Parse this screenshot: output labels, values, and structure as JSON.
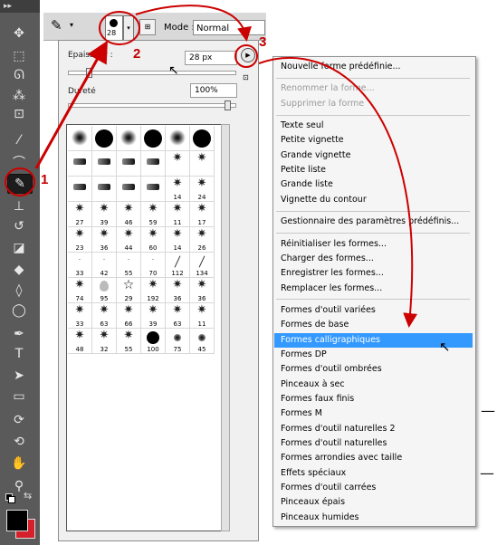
{
  "toolbar": {
    "strip": "▸▸",
    "tools": [
      {
        "name": "move-icon",
        "glyph": "✥"
      },
      {
        "name": "marquee-icon",
        "glyph": "⬚"
      },
      {
        "name": "lasso-icon",
        "glyph": "ᘏ"
      },
      {
        "name": "magic-wand-icon",
        "glyph": "⁂"
      },
      {
        "name": "crop-icon",
        "glyph": "⊡"
      },
      {
        "name": "eyedropper-icon",
        "glyph": "⁄"
      },
      {
        "name": "healing-brush-icon",
        "glyph": "⌒"
      },
      {
        "name": "brush-icon",
        "glyph": "✎"
      },
      {
        "name": "stamp-icon",
        "glyph": "⊥"
      },
      {
        "name": "history-brush-icon",
        "glyph": "↺"
      },
      {
        "name": "eraser-icon",
        "glyph": "◪"
      },
      {
        "name": "paint-bucket-icon",
        "glyph": "◆"
      },
      {
        "name": "blur-icon",
        "glyph": "◊"
      },
      {
        "name": "dodge-icon",
        "glyph": "◯"
      },
      {
        "name": "pen-icon",
        "glyph": "✒"
      },
      {
        "name": "type-icon",
        "glyph": "T"
      },
      {
        "name": "path-selection-icon",
        "glyph": "➤"
      },
      {
        "name": "shape-icon",
        "glyph": "▭"
      },
      {
        "name": "3d-rotate-icon",
        "glyph": "⟳"
      },
      {
        "name": "3d-orbit-icon",
        "glyph": "⟲"
      },
      {
        "name": "hand-icon",
        "glyph": "✋"
      },
      {
        "name": "zoom-icon",
        "glyph": "⚲"
      }
    ]
  },
  "optionsbar": {
    "brush_size": "28",
    "mode_label": "Mode :",
    "mode_value": "Normal"
  },
  "picker": {
    "size_label": "Epaisseur :",
    "size_value": "28 px",
    "hardness_label": "Dureté",
    "hardness_value": "100%"
  },
  "brushes": [
    [
      "",
      "",
      "",
      "",
      "",
      ""
    ],
    [
      "",
      "",
      "",
      "",
      "",
      ""
    ],
    [
      "",
      "",
      "",
      "",
      "14",
      "24"
    ],
    [
      "27",
      "39",
      "46",
      "59",
      "11",
      "17"
    ],
    [
      "23",
      "36",
      "44",
      "60",
      "14",
      "26"
    ],
    [
      "33",
      "42",
      "55",
      "70",
      "112",
      "134"
    ],
    [
      "74",
      "95",
      "29",
      "192",
      "36",
      "36"
    ],
    [
      "33",
      "63",
      "66",
      "39",
      "63",
      "11"
    ],
    [
      "48",
      "32",
      "55",
      "100",
      "75",
      "45"
    ]
  ],
  "menu": {
    "groups": [
      [
        {
          "label": "Nouvelle forme prédéfinie...",
          "disabled": false
        }
      ],
      [
        {
          "label": "Renommer la forme...",
          "disabled": true
        },
        {
          "label": "Supprimer la forme",
          "disabled": true
        }
      ],
      [
        {
          "label": "Texte seul",
          "disabled": false
        },
        {
          "label": "Petite vignette",
          "disabled": false
        },
        {
          "label": "Grande vignette",
          "disabled": false
        },
        {
          "label": "Petite liste",
          "disabled": false
        },
        {
          "label": "Grande liste",
          "disabled": false
        },
        {
          "label": "Vignette du contour",
          "disabled": false
        }
      ],
      [
        {
          "label": "Gestionnaire des paramètres prédéfinis...",
          "disabled": false
        }
      ],
      [
        {
          "label": "Réinitialiser les formes...",
          "disabled": false
        },
        {
          "label": "Charger des formes...",
          "disabled": false
        },
        {
          "label": "Enregistrer les formes...",
          "disabled": false
        },
        {
          "label": "Remplacer les formes...",
          "disabled": false
        }
      ],
      [
        {
          "label": "Formes d'outil variées",
          "disabled": false
        },
        {
          "label": "Formes de base",
          "disabled": false
        },
        {
          "label": "Formes calligraphiques",
          "disabled": false,
          "highlighted": true
        },
        {
          "label": "Formes DP",
          "disabled": false
        },
        {
          "label": "Formes d'outil ombrées",
          "disabled": false
        },
        {
          "label": "Pinceaux à sec",
          "disabled": false
        },
        {
          "label": "Formes faux finis",
          "disabled": false
        },
        {
          "label": "Formes M",
          "disabled": false
        },
        {
          "label": "Formes d'outil naturelles 2",
          "disabled": false
        },
        {
          "label": "Formes d'outil naturelles",
          "disabled": false
        },
        {
          "label": "Formes arrondies avec taille",
          "disabled": false
        },
        {
          "label": "Effets spéciaux",
          "disabled": false
        },
        {
          "label": "Formes d'outil carrées",
          "disabled": false
        },
        {
          "label": "Pinceaux épais",
          "disabled": false
        },
        {
          "label": "Pinceaux humides",
          "disabled": false
        }
      ]
    ]
  },
  "annotations": {
    "step1": "1",
    "step2": "2",
    "step3": "3",
    "color": "#cc0000"
  },
  "colors": {
    "highlight": "#3399ff",
    "foreground": "#000000",
    "background": "#d4202b"
  }
}
